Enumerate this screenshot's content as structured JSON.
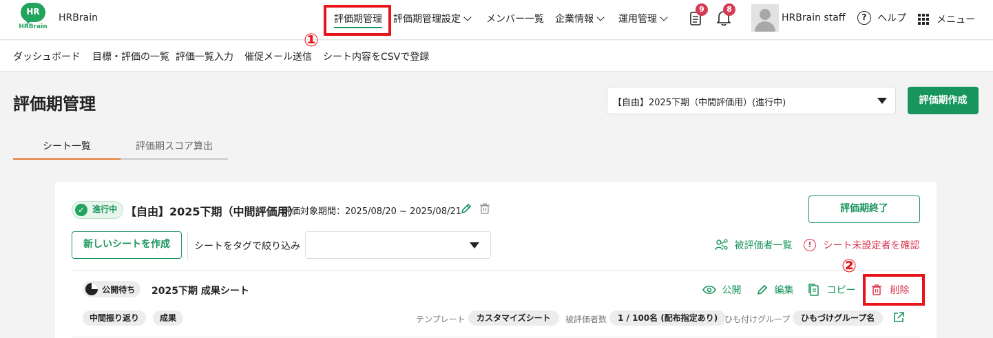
{
  "header": {
    "logo_text": "HR",
    "logo_subtext": "HRBrain",
    "company": "HRBrain",
    "nav": [
      {
        "label": "評価期管理"
      },
      {
        "label": "評価期管理設定"
      },
      {
        "label": "メンバー一覧"
      },
      {
        "label": "企業情報"
      },
      {
        "label": "運用管理"
      }
    ],
    "badge_docs": "9",
    "badge_bell": "8",
    "user": "HRBrain staff",
    "help": "ヘルプ",
    "menu": "メニュー"
  },
  "subnav": [
    "ダッシュボード",
    "目標・評価の一覧",
    "評価一覧入力",
    "催促メール送信",
    "シート内容をCSVで登録"
  ],
  "page": {
    "title": "評価期管理",
    "period_select": "【自由】2025下期（中間評価用）(進行中)",
    "create_button": "評価期作成",
    "tabs": [
      "シート一覧",
      "評価期スコア算出"
    ]
  },
  "period": {
    "status": "進行中",
    "name": "【自由】2025下期（中間評価用）",
    "range": "評価対象期間：2025/08/20 ~ 2025/08/21",
    "end_button": "評価期終了",
    "new_sheet_button": "新しいシートを作成",
    "filter_label": "シートをタグで絞り込み",
    "evaluatees_link": "被評価者一覧",
    "unset_link": "シート未設定者を確認"
  },
  "sheet": {
    "status": "公開待ち",
    "name": "2025下期 成果シート",
    "actions": {
      "publish": "公開",
      "edit": "編集",
      "copy": "コピー",
      "delete": "削除"
    },
    "tags": [
      "中間振り返り",
      "成果"
    ],
    "template_label": "テンプレート",
    "template_value": "カスタマイズシート",
    "evaluatee_label": "被評価者数",
    "evaluatee_value": "1 / 100名 (配布指定あり)",
    "group_label": "ひも付けグループ",
    "group_value": "ひもづけグループ名"
  },
  "annotations": [
    "①",
    "②"
  ],
  "colors": {
    "brand_green": "#18955c",
    "badge_red": "#d63b55",
    "highlight_red": "#e8141c",
    "danger_red": "#d9364f"
  }
}
